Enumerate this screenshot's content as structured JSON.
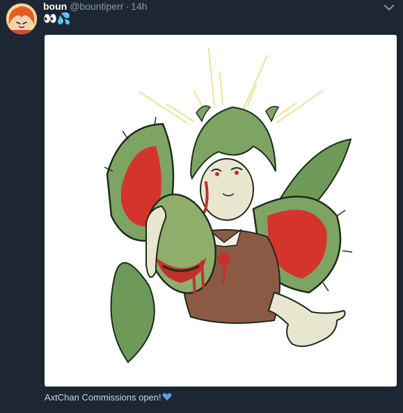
{
  "tweet": {
    "display_name": "boun",
    "handle": "@bountiperr",
    "separator": "·",
    "timestamp": "14h",
    "text": "👀💦"
  },
  "image_caption": {
    "text": "AxtChan Commissions open!"
  },
  "icons": {
    "caret": "chevron-down-icon",
    "heart": "blue-heart-icon",
    "avatar": "avatar-illustration"
  },
  "colors": {
    "background": "#1c2733",
    "muted": "#8899a6",
    "heart": "#5aa0e6"
  }
}
